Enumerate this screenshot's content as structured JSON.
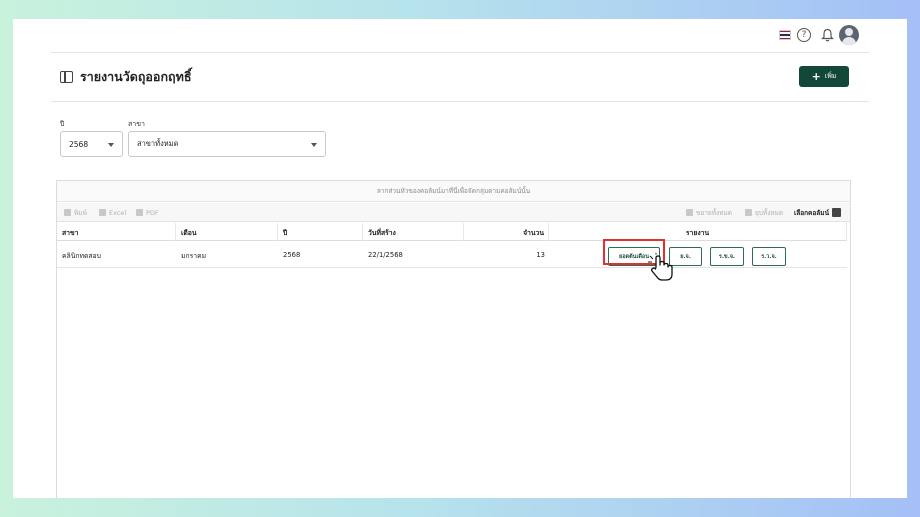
{
  "topbar": {
    "icons": [
      "thai-flag-icon",
      "help-icon",
      "bell-icon",
      "avatar-icon"
    ],
    "flag_colors": [
      "#a51931",
      "#f4f5f8",
      "#2d2a4a",
      "#f4f5f8",
      "#a51931"
    ]
  },
  "header": {
    "title": "รายงานวัดถุออกฤทธิ์",
    "add_label": "เพิ่ม",
    "add_color": "#12473a"
  },
  "filters": {
    "year_label": "ปี",
    "year_value": "2568",
    "branch_label": "สาขา",
    "branch_value": "สาขาทั้งหมด"
  },
  "grid": {
    "group_hint": "ลากส่วนหัวของคอลัมน์มาที่นี่เพื่อจัดกลุ่มตามคอลัมน์นั้น",
    "toolbar": {
      "print": "พิมพ์",
      "excel": "Excel",
      "pdf": "PDF",
      "expand_all": "ขยายทั้งหมด",
      "collapse_all": "ยุบทั้งหมด",
      "choose_columns": "เลือกคอลัมน์"
    },
    "columns": [
      "สาขา",
      "เดือน",
      "ปี",
      "วันที่สร้าง",
      "จำนวน",
      "รายงาน"
    ],
    "rows": [
      {
        "branch": "คลินิกทดสอบ",
        "month": "มกราคม",
        "year": "2568",
        "created": "22/1/2568",
        "count": "13",
        "actions": [
          "ยอดต้นเดือน",
          "ย.จ.",
          "ร.ข.จ.",
          "ร.ว.จ."
        ]
      }
    ]
  },
  "accent": {
    "highlight": "#e03030"
  }
}
